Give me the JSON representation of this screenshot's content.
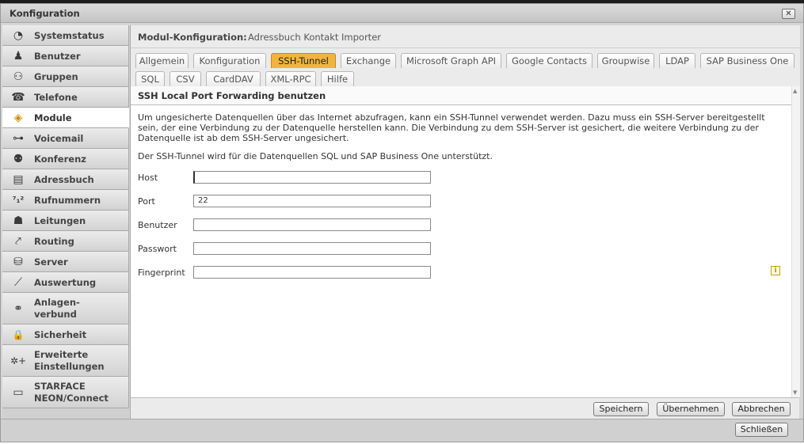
{
  "window": {
    "title": "Konfiguration",
    "close_glyph": "✕"
  },
  "sidebar": {
    "items": [
      {
        "label": "Systemstatus",
        "icon": "gauge-icon",
        "glyph": "◔"
      },
      {
        "label": "Benutzer",
        "icon": "user-icon",
        "glyph": "♟"
      },
      {
        "label": "Gruppen",
        "icon": "group-icon",
        "glyph": "⚇"
      },
      {
        "label": "Telefone",
        "icon": "phone-icon",
        "glyph": "☎"
      },
      {
        "label": "Module",
        "icon": "cube-icon",
        "glyph": "◈",
        "active": true
      },
      {
        "label": "Voicemail",
        "icon": "voicemail-icon",
        "glyph": "⊶"
      },
      {
        "label": "Konferenz",
        "icon": "conference-icon",
        "glyph": "⚉"
      },
      {
        "label": "Adressbuch",
        "icon": "addressbook-icon",
        "glyph": "▤"
      },
      {
        "label": "Rufnummern",
        "icon": "numbers-icon",
        "glyph": "⁷₁²"
      },
      {
        "label": "Leitungen",
        "icon": "lines-icon",
        "glyph": "☗"
      },
      {
        "label": "Routing",
        "icon": "routing-icon",
        "glyph": "⤤"
      },
      {
        "label": "Server",
        "icon": "server-icon",
        "glyph": "⛁"
      },
      {
        "label": "Auswertung",
        "icon": "chart-icon",
        "glyph": "⟋"
      },
      {
        "label_line1": "Anlagen-",
        "label_line2": "verbund",
        "icon": "network-icon",
        "glyph": "⚭"
      },
      {
        "label": "Sicherheit",
        "icon": "lock-icon",
        "glyph": "🔒"
      },
      {
        "label_line1": "Erweiterte",
        "label_line2": "Einstellungen",
        "icon": "advanced-settings-icon",
        "glyph": "✲+"
      },
      {
        "label_line1": "STARFACE",
        "label_line2": "NEON/Connect",
        "icon": "camera-icon",
        "glyph": "▭"
      }
    ]
  },
  "module": {
    "key": "Modul-Konfiguration:",
    "value": "Adressbuch Kontakt Importer"
  },
  "tabs": {
    "row1": [
      "Allgemein",
      "Konfiguration",
      "SSH-Tunnel",
      "Exchange",
      "Microsoft Graph API",
      "Google Contacts",
      "Groupwise",
      "LDAP",
      "SAP Business One"
    ],
    "row2": [
      "SQL",
      "CSV",
      "CardDAV",
      "XML-RPC",
      "Hilfe"
    ],
    "active": "SSH-Tunnel"
  },
  "section": {
    "title": "SSH Local Port Forwarding benutzen",
    "description": "Um ungesicherte Datenquellen über das Internet abzufragen, kann ein SSH-Tunnel verwendet werden. Dazu muss ein SSH-Server bereitgestellt sein, der eine Verbindung zu der Datenquelle herstellen kann. Die Verbindung zu dem SSH-Server ist gesichert, die weitere Verbindung zu der Datenquelle ist ab dem SSH-Server ungesichert.",
    "note": "Der SSH-Tunnel wird für die Datenquellen SQL und SAP Business One unterstützt."
  },
  "form": {
    "host_label": "Host",
    "host_value": "",
    "port_label": "Port",
    "port_value": "22",
    "user_label": "Benutzer",
    "user_value": "",
    "password_label": "Passwort",
    "password_value": "",
    "fingerprint_label": "Fingerprint",
    "fingerprint_value": ""
  },
  "buttons": {
    "save": "Speichern",
    "apply": "Übernehmen",
    "cancel": "Abbrechen",
    "close": "Schließen"
  },
  "colors": {
    "active_tab": "#f0b43f",
    "info_icon": "#d2a000"
  }
}
